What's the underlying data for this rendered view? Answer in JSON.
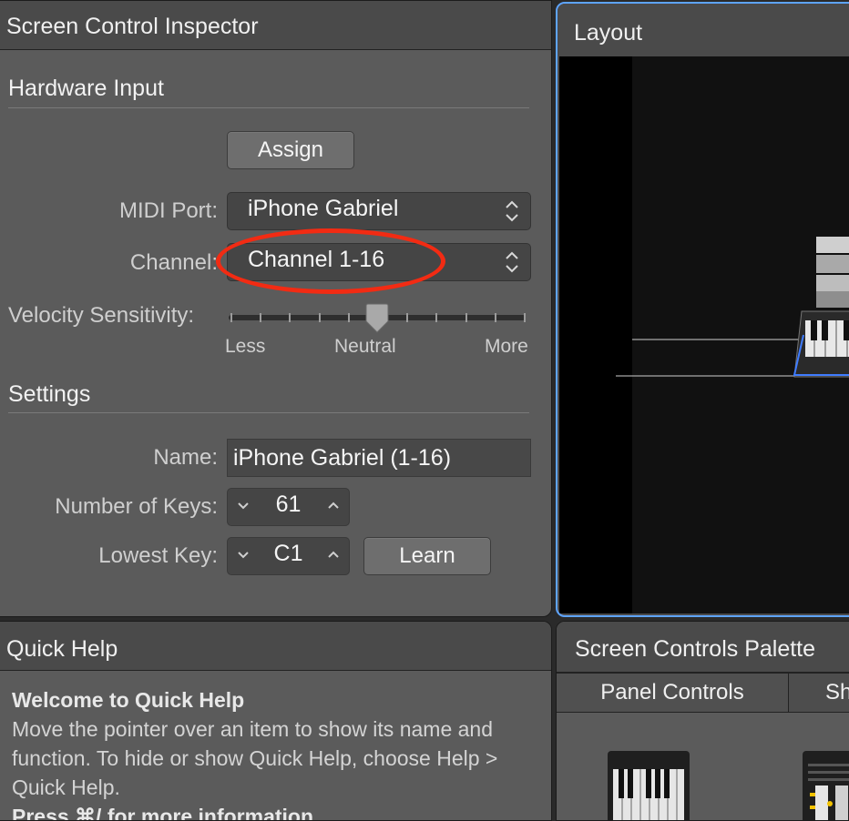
{
  "inspector": {
    "title": "Screen Control Inspector",
    "hardware_section": "Hardware Input",
    "assign_label": "Assign",
    "midi_port_label": "MIDI Port:",
    "midi_port_value": "iPhone Gabriel",
    "channel_label": "Channel:",
    "channel_value": "Channel 1-16",
    "velocity_label": "Velocity Sensitivity:",
    "velocity_less": "Less",
    "velocity_neutral": "Neutral",
    "velocity_more": "More",
    "velocity_level": 0.5,
    "settings_section": "Settings",
    "name_label": "Name:",
    "name_value": "iPhone Gabriel (1-16)",
    "keys_label": "Number of Keys:",
    "keys_value": "61",
    "lowest_label": "Lowest Key:",
    "lowest_value": "C1",
    "learn_label": "Learn"
  },
  "layout": {
    "title": "Layout"
  },
  "quick_help": {
    "title": "Quick Help",
    "heading": "Welcome to Quick Help",
    "body": "Move the pointer over an item to show its name and function. To hide or show Quick Help, choose Help > Quick Help.",
    "footer": "Press ⌘/ for more information."
  },
  "palette": {
    "title": "Screen Controls Palette",
    "tabs": [
      "Panel Controls",
      "Sh"
    ]
  },
  "colors": {
    "annotation": "#f22b13",
    "focus_border": "#5ea4ff"
  }
}
